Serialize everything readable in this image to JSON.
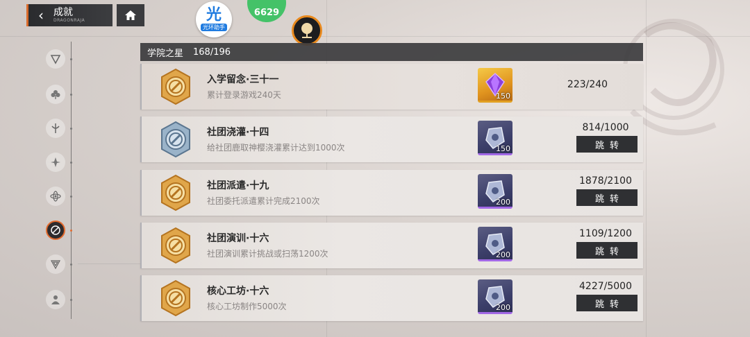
{
  "nav": {
    "title": "成就",
    "subtitle": "DRAGONRAJA"
  },
  "badges": {
    "guang_main": "光",
    "guang_label": "光环助手",
    "green_text": "6629"
  },
  "categories": [
    {
      "icon": "triangle-crest-icon"
    },
    {
      "icon": "clover-icon"
    },
    {
      "icon": "trident-icon"
    },
    {
      "icon": "shuriken-icon"
    },
    {
      "icon": "atom-icon"
    },
    {
      "icon": "compass-slash-icon",
      "active": true
    },
    {
      "icon": "shield-crest-icon"
    },
    {
      "icon": "bust-icon"
    }
  ],
  "header": {
    "name": "学院之星",
    "count": "168/196"
  },
  "achievements": [
    {
      "title": "入学留念·三十一",
      "desc": "累计登录游戏240天",
      "reward_qty": "150",
      "reward_type": "gold",
      "progress": "223/240",
      "has_jump": false
    },
    {
      "title": "社团浇灌·十四",
      "desc": "给社团鹿取神樱浇灌累计达到1000次",
      "reward_qty": "150",
      "reward_type": "purple",
      "progress": "814/1000",
      "has_jump": true,
      "jump_label": "跳转",
      "medal": "silver"
    },
    {
      "title": "社团派遣·十九",
      "desc": "社团委托派遣累计完成2100次",
      "reward_qty": "200",
      "reward_type": "purple",
      "progress": "1878/2100",
      "has_jump": true,
      "jump_label": "跳转"
    },
    {
      "title": "社团演训·十六",
      "desc": "社团演训累计挑战或扫荡1200次",
      "reward_qty": "200",
      "reward_type": "purple",
      "progress": "1109/1200",
      "has_jump": true,
      "jump_label": "跳转"
    },
    {
      "title": "核心工坊·十六",
      "desc": "核心工坊制作5000次",
      "reward_qty": "200",
      "reward_type": "purple",
      "progress": "4227/5000",
      "has_jump": true,
      "jump_label": "跳转"
    }
  ],
  "colors": {
    "accent": "#e26a2e",
    "bronze": "#d99a3f",
    "silver": "#7d9ab6",
    "purple": "#a268e6"
  }
}
